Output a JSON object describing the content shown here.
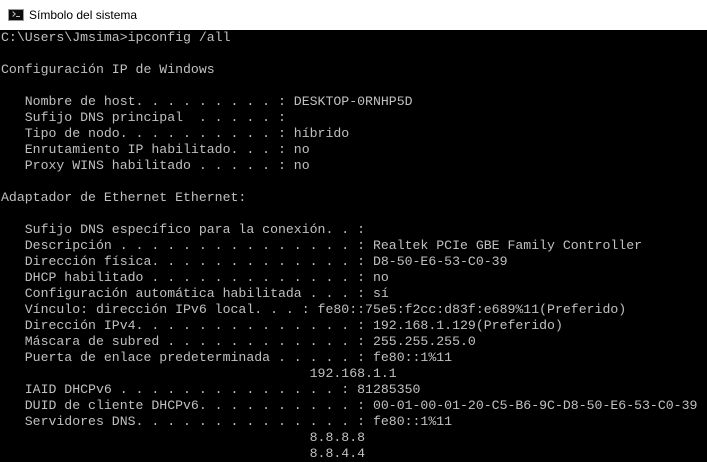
{
  "window": {
    "title": "Símbolo del sistema",
    "icon": "console-icon"
  },
  "console": {
    "lines": [
      "C:\\Users\\Jmsima>ipconfig /all",
      "",
      "Configuración IP de Windows",
      "",
      "   Nombre de host. . . . . . . . . : DESKTOP-0RNHP5D",
      "   Sufijo DNS principal  . . . . . :",
      "   Tipo de nodo. . . . . . . . . . : híbrido",
      "   Enrutamiento IP habilitado. . . : no",
      "   Proxy WINS habilitado . . . . . : no",
      "",
      "Adaptador de Ethernet Ethernet:",
      "",
      "   Sufijo DNS específico para la conexión. . :",
      "   Descripción . . . . . . . . . . . . . . . : Realtek PCIe GBE Family Controller",
      "   Dirección física. . . . . . . . . . . . . : D8-50-E6-53-C0-39",
      "   DHCP habilitado . . . . . . . . . . . . . : no",
      "   Configuración automática habilitada . . . : sí",
      "   Vínculo: dirección IPv6 local. . . : fe80::75e5:f2cc:d83f:e689%11(Preferido)",
      "   Dirección IPv4. . . . . . . . . . . . . . : 192.168.1.129(Preferido)",
      "   Máscara de subred . . . . . . . . . . . . : 255.255.255.0",
      "   Puerta de enlace predeterminada . . . . . : fe80::1%11",
      "                                       192.168.1.1",
      "   IAID DHCPv6 . . . . . . . . . . . . . . : 81285350",
      "   DUID de cliente DHCPv6. . . . . . . . . . : 00-01-00-01-20-C5-B6-9C-D8-50-E6-53-C0-39",
      "   Servidores DNS. . . . . . . . . . . . . . : fe80::1%11",
      "                                       8.8.8.8",
      "                                       8.8.4.4"
    ]
  }
}
